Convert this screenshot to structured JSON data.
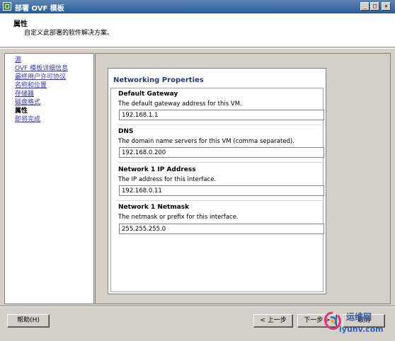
{
  "window": {
    "title": "部署 OVF 模板",
    "buttons": [
      "_",
      "□",
      "×"
    ]
  },
  "header": {
    "title": "属性",
    "subtitle": "自定义此部署的软件解决方案。"
  },
  "nav": {
    "items": [
      {
        "label": "源",
        "active": false
      },
      {
        "label": "OVF 模板详细信息",
        "active": false
      },
      {
        "label": "最终用户许可协议",
        "active": false
      },
      {
        "label": "名称和位置",
        "active": false
      },
      {
        "label": "存储器",
        "active": false
      },
      {
        "label": "磁盘格式",
        "active": false
      },
      {
        "label": "属性",
        "active": true
      },
      {
        "label": "即将完成",
        "active": false
      }
    ]
  },
  "panel": {
    "title": "Networking Properties",
    "fields": [
      {
        "title": "Default Gateway",
        "description": "The default gateway address for this VM.",
        "value": "192.168.1.1"
      },
      {
        "title": "DNS",
        "description": "The domain name servers for this VM (comma separated).",
        "value": "192.168.0.200"
      },
      {
        "title": "Network 1 IP Address",
        "description": "The IP address for this interface.",
        "value": "192.168.0.11"
      },
      {
        "title": "Network 1 Netmask",
        "description": "The netmask or prefix for this interface.",
        "value": "255.255.255.0"
      }
    ]
  },
  "footer": {
    "help": "帮助(H)",
    "back": "< 上一步",
    "next": "下一步 >",
    "cancel": "取消"
  },
  "watermark": {
    "cn": "运维网",
    "url": "iyunv.com"
  }
}
